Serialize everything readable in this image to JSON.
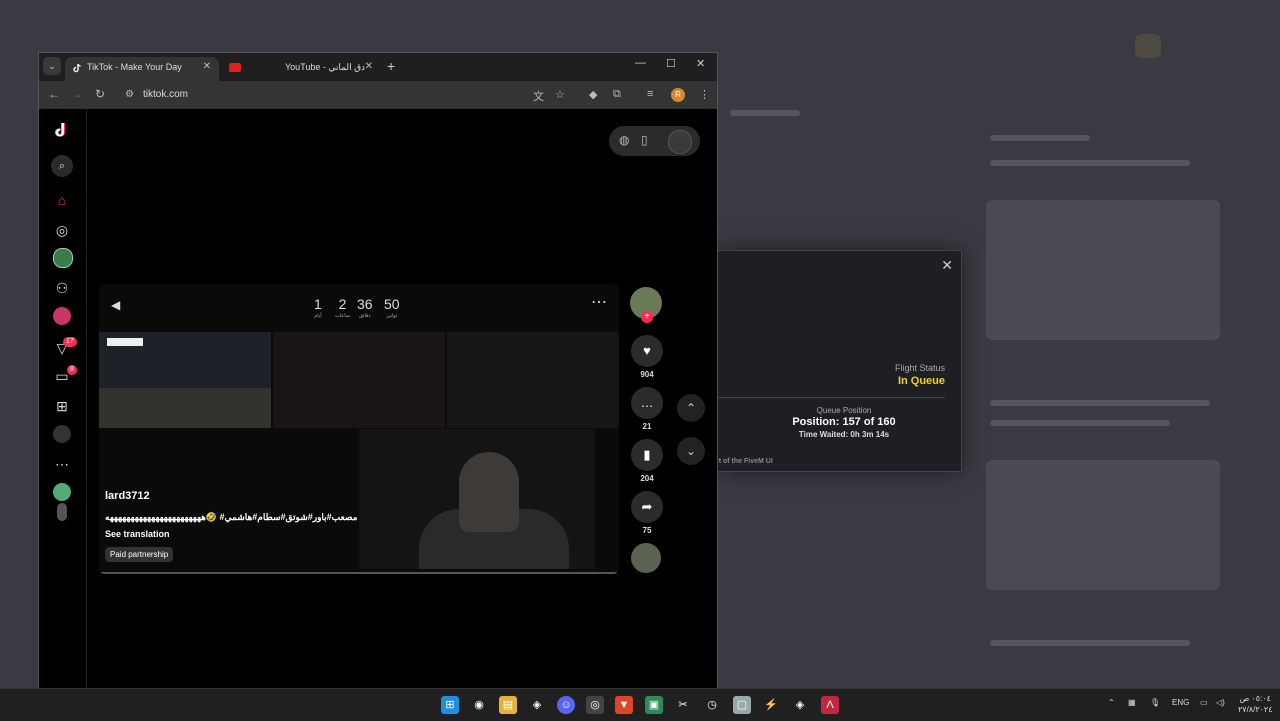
{
  "browser": {
    "tabs": [
      {
        "title": "TikTok - Make Your Day",
        "active": true
      },
      {
        "title": "YouTube - دق الماني",
        "active": false
      }
    ],
    "url": "tiktok.com",
    "profile_initial": "R"
  },
  "video": {
    "countdown": [
      {
        "value": "1",
        "unit": "أيام"
      },
      {
        "value": "2",
        "unit": "ساعات"
      },
      {
        "value": "36",
        "unit": "دقائق"
      },
      {
        "value": "50",
        "unit": "ثواني"
      }
    ],
    "author": "lard3712",
    "caption": "مصعب#باور#شوتق#سطام#هاشمي# 🤣هههههههههههههههههههههههه",
    "see_translation": "See translation",
    "paid_partnership": "Paid partnership",
    "likes": "904",
    "comments": "21",
    "bookmarks": "204",
    "shares": "75"
  },
  "fivem": {
    "flight_status_label": "Flight Status",
    "flight_status_value": "In Queue",
    "queue_position_label": "Queue Position",
    "queue_position_value": "Position: 157 of 160",
    "time_waited": "Time Waited: 0h 3m 14s",
    "footer": "rt of the FiveM UI"
  },
  "taskbar": {
    "language": "ENG",
    "time": "٠٥:٠٤ ص",
    "date": "٢٧/٨/٢٠٢٤"
  },
  "badges": {
    "sidebar_activity": "17",
    "sidebar_messages": "8"
  },
  "colors": {
    "tiktok_red": "#fe2c55",
    "status_yellow": "#f3d11a",
    "accent_orange": "#d9872b"
  }
}
